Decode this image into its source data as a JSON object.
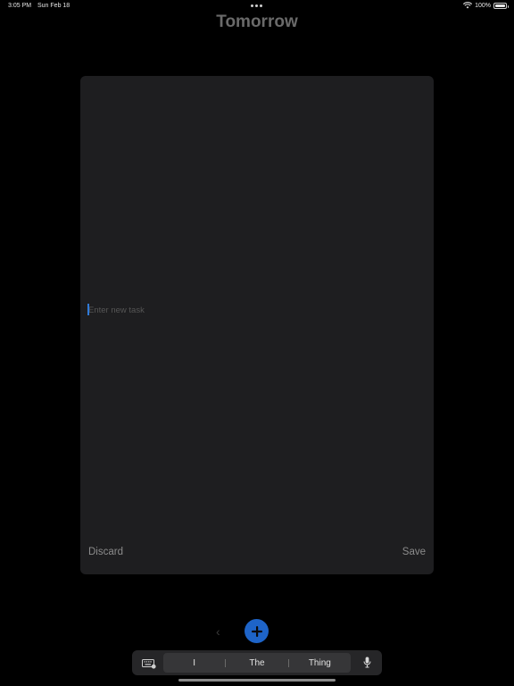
{
  "status_bar": {
    "time": "3:05 PM",
    "date": "Sun Feb 18",
    "battery": "100%",
    "battery_level": 1.0,
    "icons": [
      "wifi-icon",
      "battery-icon"
    ]
  },
  "header": {
    "title": "Tomorrow"
  },
  "editor": {
    "placeholder": "Enter new task",
    "value": "",
    "discard_label": "Discard",
    "save_label": "Save"
  },
  "bottom": {
    "back_icon": "chevron-left-icon",
    "add_icon": "plus-icon",
    "back_glyph": "‹"
  },
  "keyboard": {
    "suggestions": [
      "I",
      "The",
      "Thing"
    ],
    "icons": [
      "keyboard-icon",
      "microphone-icon"
    ]
  },
  "colors": {
    "background": "#000000",
    "card": "#1e1e20",
    "accent": "#1e64c8",
    "caret": "#2f7ad8"
  }
}
